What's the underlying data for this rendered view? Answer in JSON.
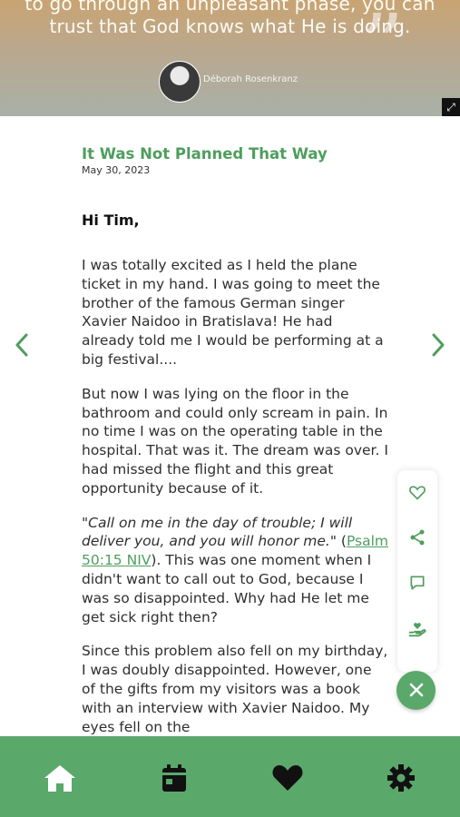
{
  "hero": {
    "quote_lines": [
      "to go through an unpleasant phase, you can",
      "trust that God knows what He is doing."
    ],
    "author": "Déborah Rosenkranz"
  },
  "article": {
    "title": "It Was Not Planned That Way",
    "date": "May 30, 2023",
    "greeting": "Hi Tim,",
    "paragraphs": [
      "I was totally excited as I held the plane ticket in my hand. I was going to meet the brother of the famous German singer Xavier Naidoo in Bratislava! He had already told me I would be performing at a big festival....",
      "But now I was lying on the floor in the bathroom and could only scream in pain. In no time I was on the operating table in the hospital. That was it. The dream was over. I had missed the flight and this great opportunity because of it."
    ],
    "verse": "\"Call on me in the day of trouble; I will deliver you, and you will honor me.\"",
    "verse_ref": "Psalm 50:15 NIV",
    "verse_after": ". This was one moment when I didn't want to call out to God, because I was so disappointed. Why had He let me get sick right then?",
    "final_paragraph": "Since this problem also fell on my birthday, I was doubly disappointed. However, one of the gifts from my visitors was a book with an interview with Xavier Naidoo. My eyes fell on the"
  },
  "icons": {
    "arrow_left": "chevron-left-icon",
    "arrow_right": "chevron-right-icon",
    "rail": [
      "heart-outline-icon",
      "share-icon",
      "comment-icon",
      "donate-hand-heart-icon"
    ],
    "fab": "close-icon",
    "nav": [
      "home-icon",
      "calendar-icon",
      "heart-icon",
      "gear-icon"
    ]
  },
  "colors": {
    "accent": "#5aa86a",
    "title": "#4e9e5e",
    "nav_icon": "#111111"
  }
}
